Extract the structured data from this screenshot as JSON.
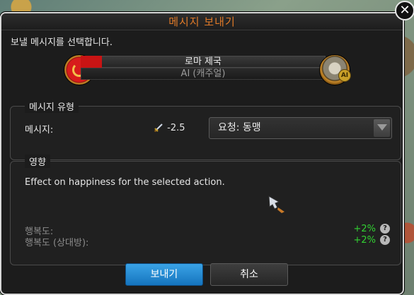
{
  "dialog": {
    "title": "메시지 보내기",
    "close_label": "✕",
    "instruction": "보낼 메시지를 선택합니다."
  },
  "civ": {
    "name": "로마 제국",
    "leader_type": "AI (캐주얼)",
    "ai_badge": "AI",
    "banner_color": "#c91414"
  },
  "message_type": {
    "legend": "메시지 유형",
    "label": "메시지:",
    "cost_value": "-2.5",
    "cost_icon": "sword-icon",
    "selected_option": "요청: 동맹"
  },
  "effect": {
    "legend": "영향",
    "description": "Effect on happiness for the selected action.",
    "rows": [
      {
        "label": "행복도:",
        "value": "+2%"
      },
      {
        "label": "행복도 (상대방):",
        "value": "+2%"
      }
    ],
    "help_glyph": "?",
    "positive_color": "#32d232"
  },
  "buttons": {
    "send": "보내기",
    "cancel": "취소"
  },
  "colors": {
    "title_accent": "#e07a28",
    "primary_button": "#1f86d1"
  }
}
